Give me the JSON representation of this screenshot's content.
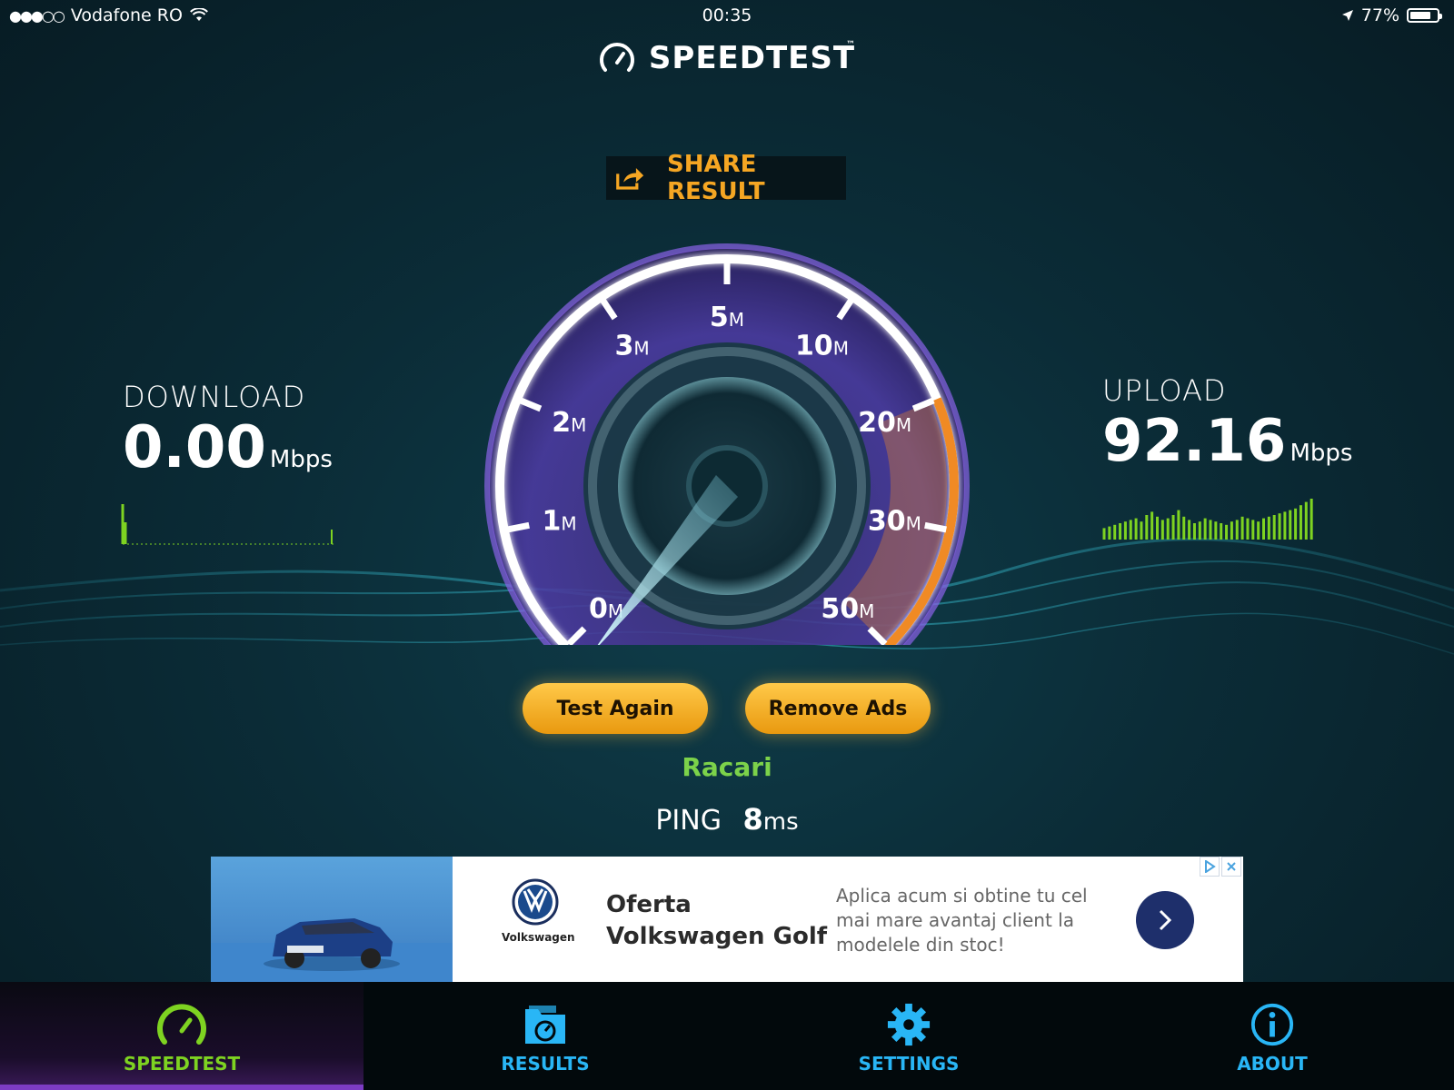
{
  "status_bar": {
    "signal": "●●●○○",
    "carrier": "Vodafone RO",
    "time": "00:35",
    "battery": "77%",
    "battery_level": 0.77
  },
  "app": {
    "logo_text": "SPEEDTEST",
    "tm": "™"
  },
  "share": {
    "label": "SHARE RESULT"
  },
  "download": {
    "label": "DOWNLOAD",
    "value": "0.00",
    "unit": "Mbps"
  },
  "upload": {
    "label": "UPLOAD",
    "value": "92.16",
    "unit": "Mbps"
  },
  "gauge": {
    "ticks": [
      {
        "num": "0",
        "unit": "M"
      },
      {
        "num": "1",
        "unit": "M"
      },
      {
        "num": "2",
        "unit": "M"
      },
      {
        "num": "3",
        "unit": "M"
      },
      {
        "num": "5",
        "unit": "M"
      },
      {
        "num": "10",
        "unit": "M"
      },
      {
        "num": "20",
        "unit": "M"
      },
      {
        "num": "30",
        "unit": "M"
      },
      {
        "num": "50",
        "unit": "M"
      }
    ],
    "needle_value": 0,
    "accent_colors": {
      "arc": "#8a63e8",
      "progress": "#f08a24"
    }
  },
  "buttons": {
    "test_again": "Test Again",
    "remove_ads": "Remove Ads"
  },
  "server": {
    "name": "Racari"
  },
  "ping": {
    "label": "PING",
    "value": "8",
    "unit": "ms"
  },
  "ad": {
    "brand": "Volkswagen",
    "headline_line1": "Oferta",
    "headline_line2": "Volkswagen Golf",
    "body": "Aplica acum si obtine tu cel mai mare avantaj client la modelele din stoc!"
  },
  "tabs": [
    {
      "label": "SPEEDTEST",
      "icon": "speedometer-icon",
      "active": true,
      "color": "#7ed321"
    },
    {
      "label": "RESULTS",
      "icon": "results-folder-icon",
      "active": false,
      "color": "#29b6f6"
    },
    {
      "label": "SETTINGS",
      "icon": "gear-icon",
      "active": false,
      "color": "#29b6f6"
    },
    {
      "label": "ABOUT",
      "icon": "info-icon",
      "active": false,
      "color": "#29b6f6"
    }
  ]
}
